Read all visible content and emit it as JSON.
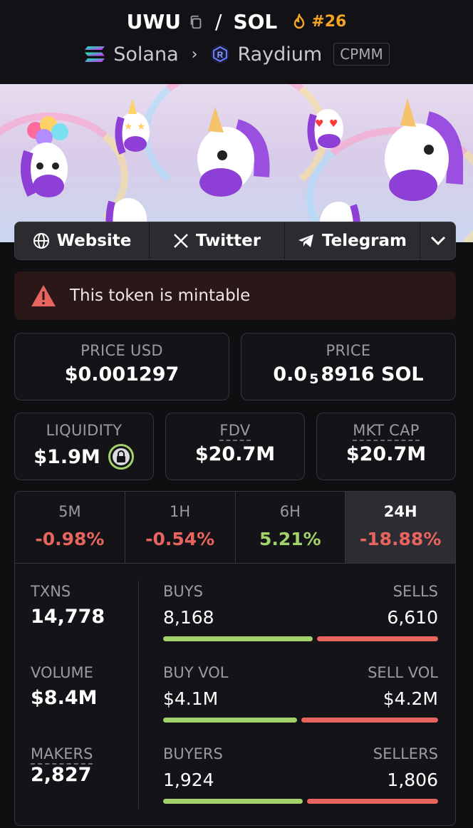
{
  "header": {
    "token": "UWU",
    "separator": "/",
    "quote": "SOL",
    "rank": "#26",
    "chain": "Solana",
    "dex": "Raydium",
    "pool_type": "CPMM"
  },
  "links": {
    "website": "Website",
    "twitter": "Twitter",
    "telegram": "Telegram"
  },
  "warning": {
    "text": "This token is mintable"
  },
  "price_usd": {
    "label": "PRICE USD",
    "value": "$0.001297"
  },
  "price": {
    "label": "PRICE",
    "prefix": "0.0",
    "zeros": "5",
    "digits": "8916 SOL"
  },
  "liquidity": {
    "label": "LIQUIDITY",
    "value": "$1.9M"
  },
  "fdv": {
    "label": "FDV",
    "value": "$20.7M"
  },
  "mkt_cap": {
    "label": "MKT CAP",
    "value": "$20.7M"
  },
  "timeframes": [
    {
      "label": "5M",
      "value": "-0.98%"
    },
    {
      "label": "1H",
      "value": "-0.54%"
    },
    {
      "label": "6H",
      "value": "5.21%"
    },
    {
      "label": "24H",
      "value": "-18.88%"
    }
  ],
  "stats": {
    "txns": {
      "label": "TXNS",
      "value": "14,778"
    },
    "volume": {
      "label": "VOLUME",
      "value": "$8.4M"
    },
    "makers": {
      "label": "MAKERS",
      "value": "2,827"
    },
    "buys": {
      "label": "BUYS",
      "value": "8,168"
    },
    "sells": {
      "label": "SELLS",
      "value": "6,610"
    },
    "buy_vol": {
      "label": "BUY VOL",
      "value": "$4.1M"
    },
    "sell_vol": {
      "label": "SELL VOL",
      "value": "$4.2M"
    },
    "buyers": {
      "label": "BUYERS",
      "value": "1,924"
    },
    "sellers": {
      "label": "SELLERS",
      "value": "1,806"
    }
  },
  "colors": {
    "positive": "#a3d16b",
    "negative": "#e8645f",
    "rank": "#f5a524",
    "warning_bg": "#2a1718"
  }
}
